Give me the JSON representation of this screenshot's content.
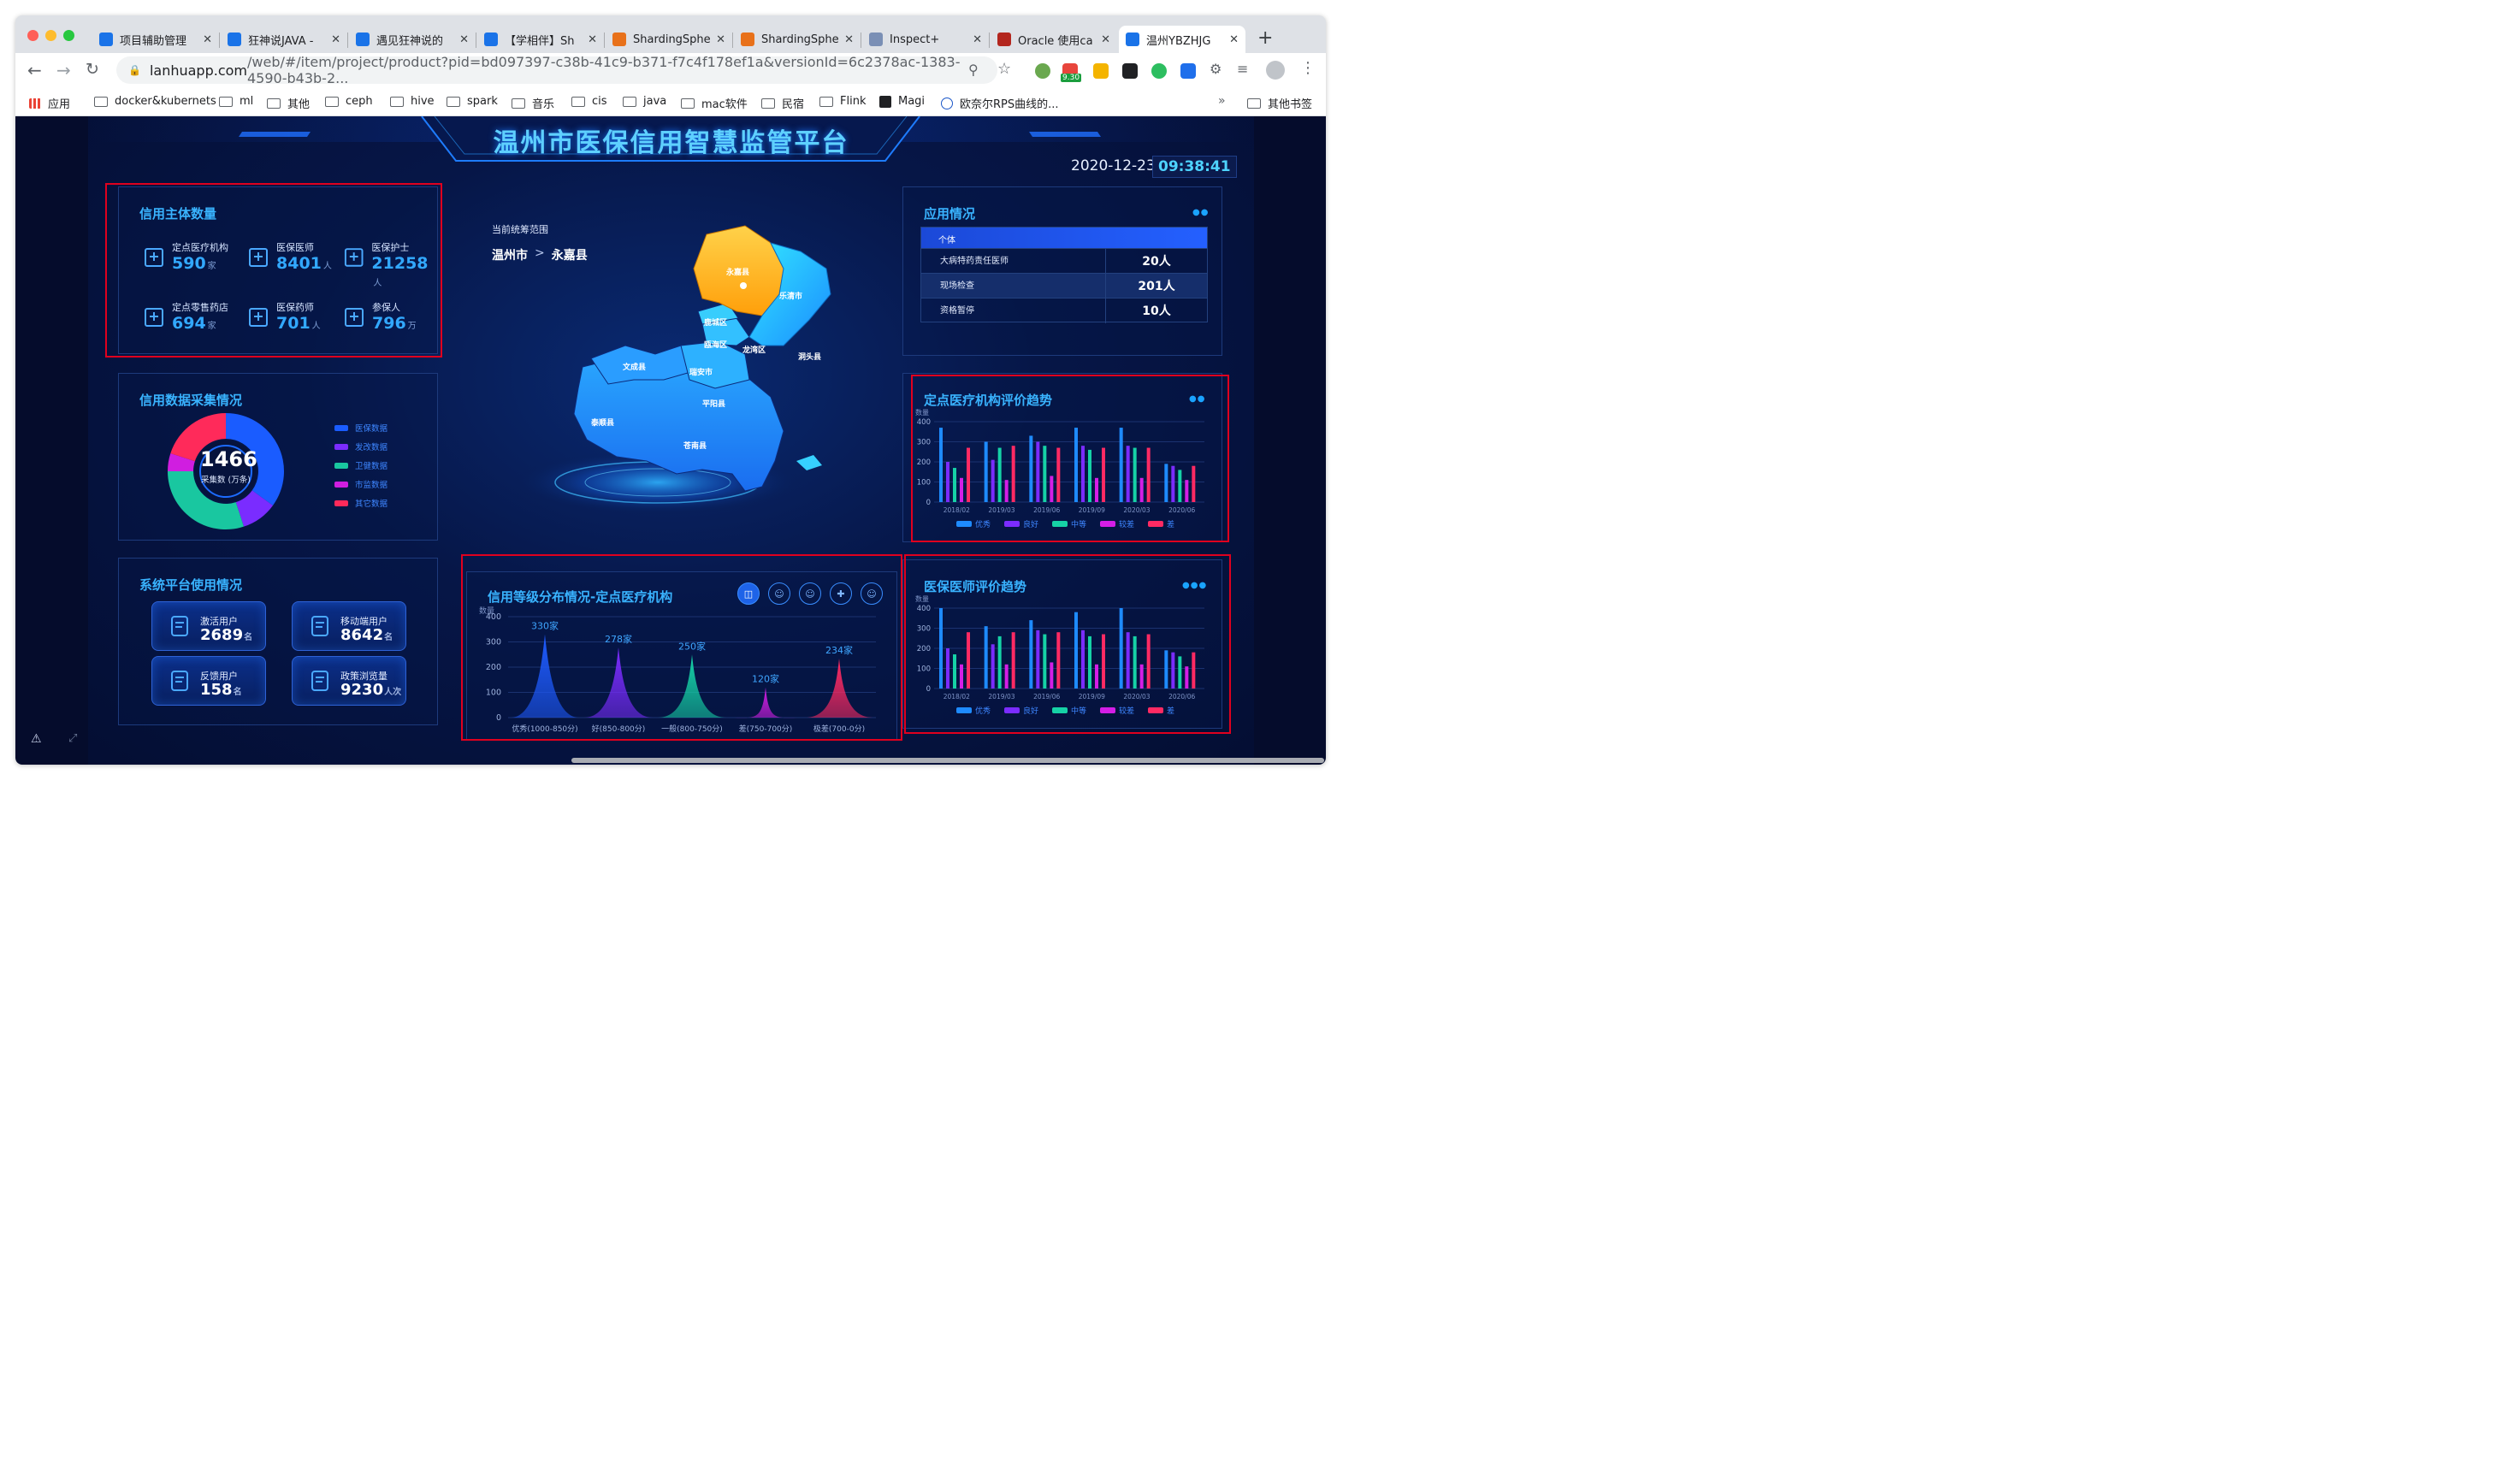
{
  "browser": {
    "tabs": [
      {
        "title": "项目辅助管理 ",
        "color": "#1a73e8"
      },
      {
        "title": "狂神说JAVA - ",
        "color": "#1a73e8"
      },
      {
        "title": "遇见狂神说的",
        "color": "#1a73e8"
      },
      {
        "title": "【学相伴】Sh",
        "color": "#1a73e8"
      },
      {
        "title": "ShardingSphe",
        "color": "#e8711a"
      },
      {
        "title": "ShardingSphe",
        "color": "#e8711a"
      },
      {
        "title": "Inspect+",
        "color": "#7a8fb5"
      },
      {
        "title": "Oracle 使用ca",
        "color": "#b3261e"
      },
      {
        "title": "温州YBZHJG",
        "color": "#1a73e8",
        "active": true
      }
    ],
    "url_main": "lanhuapp.com",
    "url_rest": "/web/#/item/project/product?pid=bd097397-c38b-41c9-b371-f7c4f178ef1a&versionId=6c2378ac-1383-4590-b43b-2...",
    "bookmarks": [
      "应用",
      "docker&kubernets",
      "ml",
      "其他",
      "ceph",
      "hive",
      "spark",
      "音乐",
      "cis",
      "java",
      "mac软件",
      "民宿",
      "Flink",
      "Magi",
      "欧奈尔RPS曲线的..."
    ],
    "other_bookmarks": "其他书签",
    "ext_badge": "9.30"
  },
  "dashboard": {
    "title": "温州市医保信用智慧监管平台",
    "date": "2020-12-23",
    "time": "09:38:41",
    "credit_subjects": {
      "title": "信用主体数量",
      "items": [
        {
          "label": "定点医疗机构",
          "value": "590",
          "unit": "家",
          "icon": "hospital-icon"
        },
        {
          "label": "医保医师",
          "value": "8401",
          "unit": "人",
          "icon": "doctor-icon"
        },
        {
          "label": "医保护士",
          "value": "21258",
          "unit": "人",
          "icon": "nurse-icon"
        },
        {
          "label": "定点零售药店",
          "value": "694",
          "unit": "家",
          "icon": "pharmacy-icon"
        },
        {
          "label": "医保药师",
          "value": "701",
          "unit": "人",
          "icon": "pharmacist-icon"
        },
        {
          "label": "参保人",
          "value": "796",
          "unit": "万",
          "icon": "person-icon"
        }
      ]
    },
    "collection": {
      "title": "信用数据采集情况",
      "total": "1466",
      "total_label": "采集数 (万条)",
      "legend": [
        {
          "name": "医保数据",
          "color": "#1a5cff"
        },
        {
          "name": "发改数据",
          "color": "#7a2cff"
        },
        {
          "name": "卫健数据",
          "color": "#19c7a0"
        },
        {
          "name": "市监数据",
          "color": "#d01ee0"
        },
        {
          "name": "其它数据",
          "color": "#ff2a5a"
        }
      ]
    },
    "usage": {
      "title": "系统平台使用情况",
      "items": [
        {
          "label": "激活用户",
          "value": "2689",
          "unit": "名",
          "icon": "activate-icon"
        },
        {
          "label": "移动端用户",
          "value": "8642",
          "unit": "名",
          "icon": "mobile-icon"
        },
        {
          "label": "反馈用户",
          "value": "158",
          "unit": "名",
          "icon": "feedback-icon"
        },
        {
          "label": "政策浏览量",
          "value": "9230",
          "unit": "人次",
          "icon": "policy-icon"
        }
      ]
    },
    "map": {
      "scope_label": "当前统筹范围",
      "city": "温州市",
      "sep": ">",
      "county": "永嘉县",
      "regions": [
        "永嘉县",
        "乐清市",
        "鹿城区",
        "瓯海区",
        "龙湾区",
        "洞头县",
        "文成县",
        "瑞安市",
        "平阳县",
        "泰顺县",
        "苍南县"
      ]
    },
    "application": {
      "title": "应用情况",
      "header": "个体",
      "rows": [
        {
          "name": "大病特药责任医师",
          "value": "20人"
        },
        {
          "name": "现场检查",
          "value": "201人"
        },
        {
          "name": "资格暂停",
          "value": "10人"
        }
      ]
    },
    "trend_institution_title": "定点医疗机构评价趋势",
    "trend_doctor_title": "医保医师评价趋势",
    "distribution_title": "信用等级分布情况-定点医疗机构"
  },
  "chart_data": [
    {
      "type": "pie",
      "title": "信用数据采集情况",
      "center_value": 1466,
      "center_label": "采集数 (万条)",
      "slices": [
        {
          "name": "医保数据",
          "value": 35
        },
        {
          "name": "发改数据",
          "value": 10
        },
        {
          "name": "卫健数据",
          "value": 30
        },
        {
          "name": "市监数据",
          "value": 5
        },
        {
          "name": "其它数据",
          "value": 20
        }
      ]
    },
    {
      "type": "area",
      "title": "信用等级分布情况-定点医疗机构",
      "ylabel": "数量",
      "ylim": [
        0,
        400
      ],
      "yticks": [
        0,
        100,
        200,
        300,
        400
      ],
      "categories": [
        "优秀(1000-850分)",
        "好(850-800分)",
        "一般(800-750分)",
        "差(750-700分)",
        "极差(700-0分)"
      ],
      "values": [
        330,
        278,
        250,
        120,
        234
      ],
      "data_labels": [
        "330家",
        "278家",
        "250家",
        "120家",
        "234家"
      ],
      "colors": [
        "#1e5bff",
        "#7b2cff",
        "#16d2a6",
        "#d41ee6",
        "#ff2a63"
      ]
    },
    {
      "type": "bar",
      "title": "定点医疗机构评价趋势",
      "ylabel": "数量",
      "ylim": [
        0,
        400
      ],
      "yticks": [
        0,
        100,
        200,
        300,
        400
      ],
      "categories": [
        "2018/02",
        "2019/03",
        "2019/06",
        "2019/09",
        "2020/03",
        "2020/06"
      ],
      "series": [
        {
          "name": "优秀",
          "values": [
            370,
            300,
            330,
            370,
            370,
            190
          ]
        },
        {
          "name": "良好",
          "values": [
            200,
            210,
            300,
            280,
            280,
            180
          ]
        },
        {
          "name": "中等",
          "values": [
            170,
            270,
            280,
            260,
            270,
            160
          ]
        },
        {
          "name": "较差",
          "values": [
            120,
            110,
            130,
            120,
            120,
            110
          ]
        },
        {
          "name": "差",
          "values": [
            270,
            280,
            270,
            270,
            270,
            180
          ]
        }
      ]
    },
    {
      "type": "bar",
      "title": "医保医师评价趋势",
      "ylabel": "数量",
      "ylim": [
        0,
        400
      ],
      "yticks": [
        0,
        100,
        200,
        300,
        400
      ],
      "categories": [
        "2018/02",
        "2019/03",
        "2019/06",
        "2019/09",
        "2020/03",
        "2020/06"
      ],
      "series": [
        {
          "name": "优秀",
          "values": [
            400,
            310,
            340,
            380,
            400,
            190
          ]
        },
        {
          "name": "良好",
          "values": [
            200,
            220,
            290,
            290,
            280,
            180
          ]
        },
        {
          "name": "中等",
          "values": [
            170,
            260,
            270,
            260,
            260,
            160
          ]
        },
        {
          "name": "较差",
          "values": [
            120,
            120,
            130,
            120,
            120,
            110
          ]
        },
        {
          "name": "差",
          "values": [
            280,
            280,
            280,
            270,
            270,
            180
          ]
        }
      ]
    }
  ]
}
